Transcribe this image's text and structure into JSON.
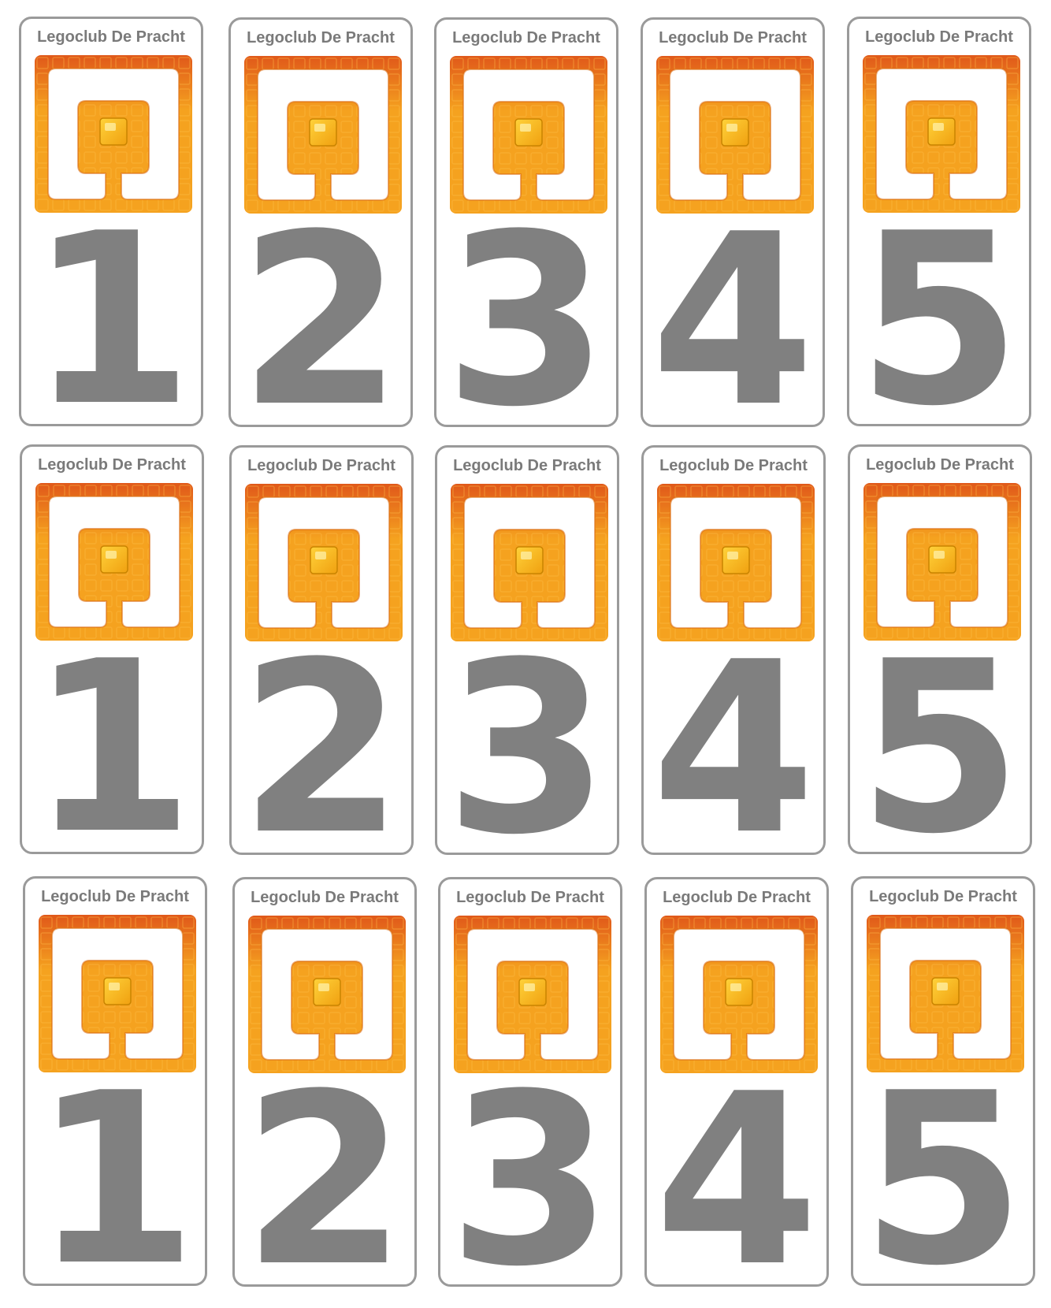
{
  "sheet": {
    "rows": [
      {
        "cards": [
          {
            "title": "Legoclub De Pracht",
            "number": "1"
          },
          {
            "title": "Legoclub De Pracht",
            "number": "2"
          },
          {
            "title": "Legoclub De Pracht",
            "number": "3"
          },
          {
            "title": "Legoclub De Pracht",
            "number": "4"
          },
          {
            "title": "Legoclub De Pracht",
            "number": "5"
          }
        ]
      },
      {
        "cards": [
          {
            "title": "Legoclub De Pracht",
            "number": "1"
          },
          {
            "title": "Legoclub De Pracht",
            "number": "2"
          },
          {
            "title": "Legoclub De Pracht",
            "number": "3"
          },
          {
            "title": "Legoclub De Pracht",
            "number": "4"
          },
          {
            "title": "Legoclub De Pracht",
            "number": "5"
          }
        ]
      },
      {
        "cards": [
          {
            "title": "Legoclub De Pracht",
            "number": "1"
          },
          {
            "title": "Legoclub De Pracht",
            "number": "2"
          },
          {
            "title": "Legoclub De Pracht",
            "number": "3"
          },
          {
            "title": "Legoclub De Pracht",
            "number": "4"
          },
          {
            "title": "Legoclub De Pracht",
            "number": "5"
          }
        ]
      }
    ]
  },
  "logo": {
    "icon": "legoclub-logo-icon",
    "colors": {
      "frame_dark": "#e0581a",
      "frame_light": "#f5a21f",
      "tile_light": "#ffd23a",
      "tile_mid": "#f0a010",
      "inner_shape": "#ffffff"
    }
  },
  "colors": {
    "card_border": "#9a9a9a",
    "title_text": "#7a7a7a",
    "number_text": "#808080",
    "background": "#ffffff"
  }
}
